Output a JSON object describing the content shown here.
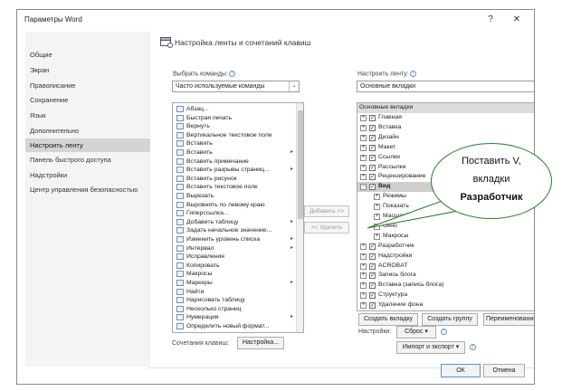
{
  "dialog": {
    "title": "Параметры Word",
    "help_glyph": "?",
    "close_glyph": "✕"
  },
  "nav": {
    "items": [
      {
        "label": "Общие"
      },
      {
        "label": "Экран"
      },
      {
        "label": "Правописание"
      },
      {
        "label": "Сохранение"
      },
      {
        "label": "Язык"
      },
      {
        "label": "Дополнительно"
      },
      {
        "label": "Настроить ленту",
        "active": true
      },
      {
        "label": "Панель быстрого доступа"
      },
      {
        "label": "Надстройки"
      },
      {
        "label": "Центр управления безопасностью"
      }
    ]
  },
  "content": {
    "title": "Настройка ленты и сочетаний клавиш",
    "choose_label": "Выбрать команды:",
    "choose_value": "Часто используемые команды",
    "customize_label": "Настроить ленту:",
    "customize_value": "Основные вкладки",
    "commands": [
      {
        "label": "Абзац...",
        "sub": ""
      },
      {
        "label": "Быстрая печать",
        "sub": ""
      },
      {
        "label": "Вернуть",
        "sub": ""
      },
      {
        "label": "Вертикальное текстовое поле",
        "sub": ""
      },
      {
        "label": "Вставить",
        "sub": ""
      },
      {
        "label": "Вставить",
        "sub": "▸"
      },
      {
        "label": "Вставить примечание",
        "sub": ""
      },
      {
        "label": "Вставить разрывы страниц...",
        "sub": "▸"
      },
      {
        "label": "Вставить рисунок",
        "sub": ""
      },
      {
        "label": "Вставить текстовое поле",
        "sub": ""
      },
      {
        "label": "Вырезать",
        "sub": ""
      },
      {
        "label": "Выровнять по левому краю",
        "sub": ""
      },
      {
        "label": "Гиперссылка...",
        "sub": ""
      },
      {
        "label": "Добавить таблицу",
        "sub": "▸"
      },
      {
        "label": "Задать начальное значение...",
        "sub": ""
      },
      {
        "label": "Изменить уровень списка",
        "sub": "▸"
      },
      {
        "label": "Интервал",
        "sub": "▸"
      },
      {
        "label": "Исправления",
        "sub": ""
      },
      {
        "label": "Копировать",
        "sub": ""
      },
      {
        "label": "Макросы",
        "sub": ""
      },
      {
        "label": "Маркеры",
        "sub": "▸"
      },
      {
        "label": "Найти",
        "sub": ""
      },
      {
        "label": "Нарисовать таблицу",
        "sub": ""
      },
      {
        "label": "Несколько страниц",
        "sub": ""
      },
      {
        "label": "Нумерация",
        "sub": "▸"
      },
      {
        "label": "Определить новый формат...",
        "sub": ""
      }
    ],
    "add_button": "Добавить >>",
    "remove_button": "<< Удалить",
    "tree_header": "Основные вкладки",
    "tree": [
      {
        "label": "Главная",
        "level": 0,
        "exp": "+",
        "checked": true
      },
      {
        "label": "Вставка",
        "level": 0,
        "exp": "+",
        "checked": true
      },
      {
        "label": "Дизайн",
        "level": 0,
        "exp": "+",
        "checked": true
      },
      {
        "label": "Макет",
        "level": 0,
        "exp": "+",
        "checked": true
      },
      {
        "label": "Ссылки",
        "level": 0,
        "exp": "+",
        "checked": true
      },
      {
        "label": "Рассылки",
        "level": 0,
        "exp": "+",
        "checked": true
      },
      {
        "label": "Рецензирование",
        "level": 0,
        "exp": "+",
        "checked": true
      },
      {
        "label": "Вид",
        "level": 0,
        "exp": "−",
        "checked": true,
        "selected": true
      },
      {
        "label": "Режимы",
        "level": 1,
        "exp": "+",
        "checked": false
      },
      {
        "label": "Показать",
        "level": 1,
        "exp": "+",
        "checked": false
      },
      {
        "label": "Масштаб",
        "level": 1,
        "exp": "+",
        "checked": false
      },
      {
        "label": "Окно",
        "level": 1,
        "exp": "+",
        "checked": false
      },
      {
        "label": "Макросы",
        "level": 1,
        "exp": "+",
        "checked": false
      },
      {
        "label": "Разработчик",
        "level": 0,
        "exp": "+",
        "checked": true
      },
      {
        "label": "Надстройки",
        "level": 0,
        "exp": "+",
        "checked": true
      },
      {
        "label": "ACROBAT",
        "level": 0,
        "exp": "+",
        "checked": true
      },
      {
        "label": "Запись блога",
        "level": 0,
        "exp": "+",
        "checked": true
      },
      {
        "label": "Вставка (запись блога)",
        "level": 0,
        "exp": "+",
        "checked": true
      },
      {
        "label": "Структура",
        "level": 0,
        "exp": "+",
        "checked": true
      },
      {
        "label": "Удаление фона",
        "level": 0,
        "exp": "+",
        "checked": true
      }
    ],
    "new_tab_button": "Создать вкладку",
    "new_group_button": "Создать группу",
    "rename_button": "Переименование...",
    "customizations_label": "Настройки:",
    "reset_button": "Сброс ▾",
    "import_export_button": "Импорт и экспорт ▾",
    "shortcuts_label": "Сочетания клавиш:",
    "shortcuts_button": "Настройка..."
  },
  "footer": {
    "ok": "ОК",
    "cancel": "Отмена"
  },
  "callout": {
    "line1": "Поставить V,",
    "line2": "вкладки",
    "line3": "Разработчик"
  }
}
